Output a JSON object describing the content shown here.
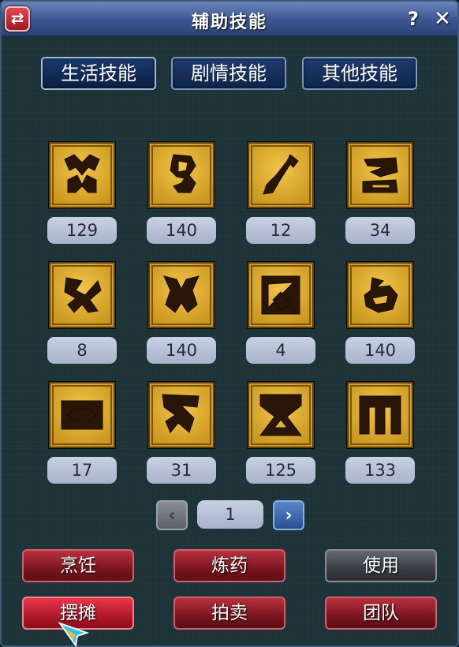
{
  "window": {
    "title": "辅助技能",
    "swap_glyph": "⇄",
    "help_glyph": "?",
    "close_glyph": "✕"
  },
  "tabs": [
    {
      "label": "生活技能",
      "active": true
    },
    {
      "label": "剧情技能",
      "active": false
    },
    {
      "label": "其他技能",
      "active": false
    }
  ],
  "skills": [
    {
      "icon": "rune-icon-1",
      "level": "129"
    },
    {
      "icon": "rune-icon-2",
      "level": "140"
    },
    {
      "icon": "trowel-icon",
      "level": "12"
    },
    {
      "icon": "rune-icon-4",
      "level": "34"
    },
    {
      "icon": "rune-icon-5",
      "level": "8"
    },
    {
      "icon": "rune-icon-6",
      "level": "140"
    },
    {
      "icon": "rune-icon-7",
      "level": "4"
    },
    {
      "icon": "rune-icon-8",
      "level": "140"
    },
    {
      "icon": "rune-icon-9",
      "level": "17"
    },
    {
      "icon": "rune-icon-10",
      "level": "31"
    },
    {
      "icon": "rune-icon-11",
      "level": "125"
    },
    {
      "icon": "rune-icon-12",
      "level": "133"
    }
  ],
  "pager": {
    "prev_glyph": "‹",
    "page": "1",
    "next_glyph": "›"
  },
  "actions": [
    {
      "label": "烹饪",
      "style": "red"
    },
    {
      "label": "炼药",
      "style": "red"
    },
    {
      "label": "使用",
      "style": "grey"
    },
    {
      "label": "摆摊",
      "style": "bright"
    },
    {
      "label": "拍卖",
      "style": "red"
    },
    {
      "label": "团队",
      "style": "red"
    }
  ],
  "colors": {
    "icon_gold": "#c9961e",
    "icon_dark": "#2a1606",
    "title_bar": "#3c5592",
    "button_red": "#7a1620"
  }
}
